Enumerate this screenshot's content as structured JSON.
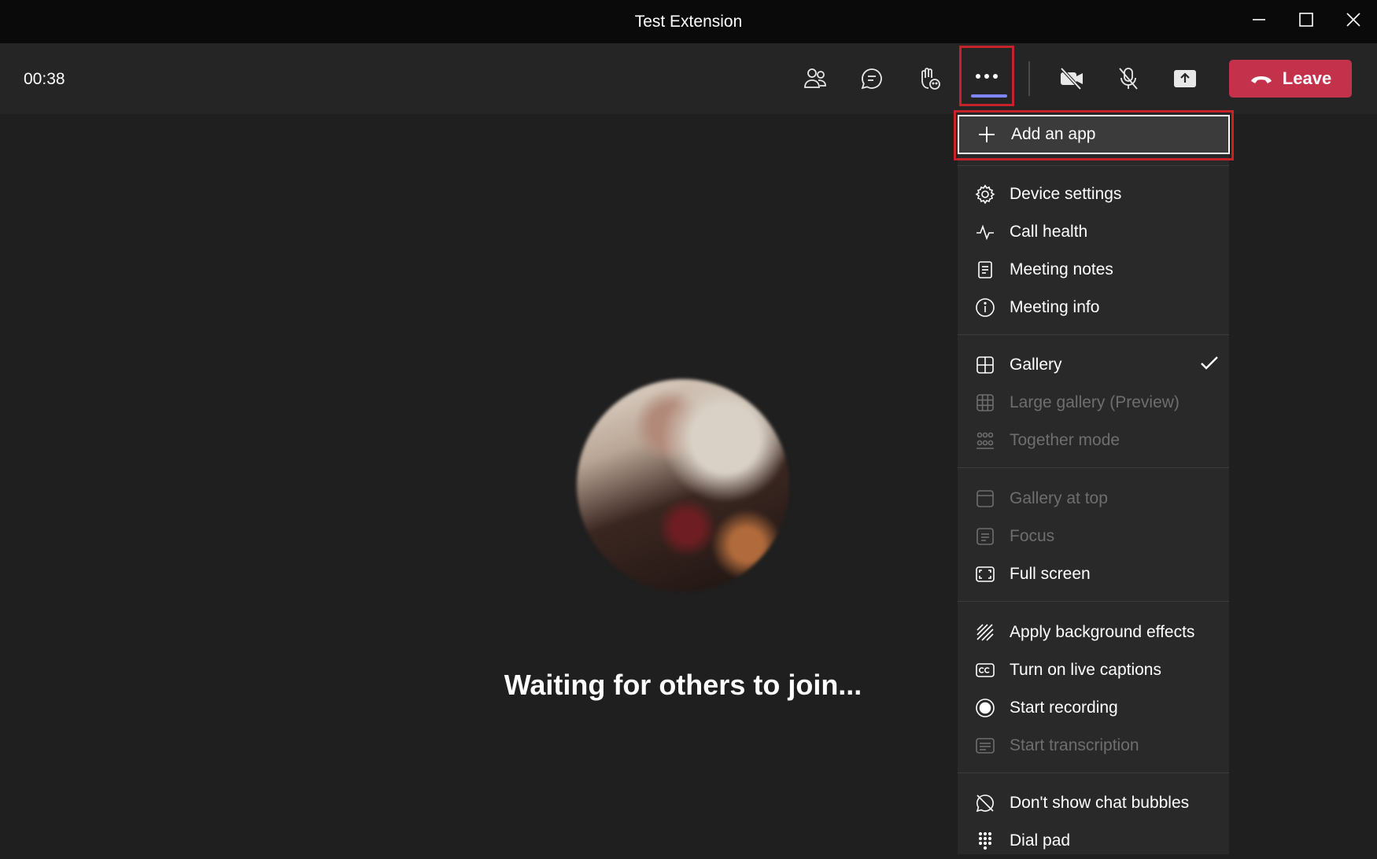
{
  "window": {
    "title": "Test Extension"
  },
  "toolbar": {
    "timer": "00:38",
    "leave_label": "Leave"
  },
  "stage": {
    "waiting_text": "Waiting for others to join..."
  },
  "menu": {
    "add_app": "Add an app",
    "device_settings": "Device settings",
    "call_health": "Call health",
    "meeting_notes": "Meeting notes",
    "meeting_info": "Meeting info",
    "gallery": "Gallery",
    "large_gallery": "Large gallery (Preview)",
    "together_mode": "Together mode",
    "gallery_at_top": "Gallery at top",
    "focus": "Focus",
    "full_screen": "Full screen",
    "background_effects": "Apply background effects",
    "live_captions": "Turn on live captions",
    "start_recording": "Start recording",
    "start_transcription": "Start transcription",
    "chat_bubbles": "Don't show chat bubbles",
    "dial_pad": "Dial pad"
  },
  "colors": {
    "leave": "#c4314b",
    "highlight": "#c4232c",
    "accent": "#7f85f5"
  }
}
